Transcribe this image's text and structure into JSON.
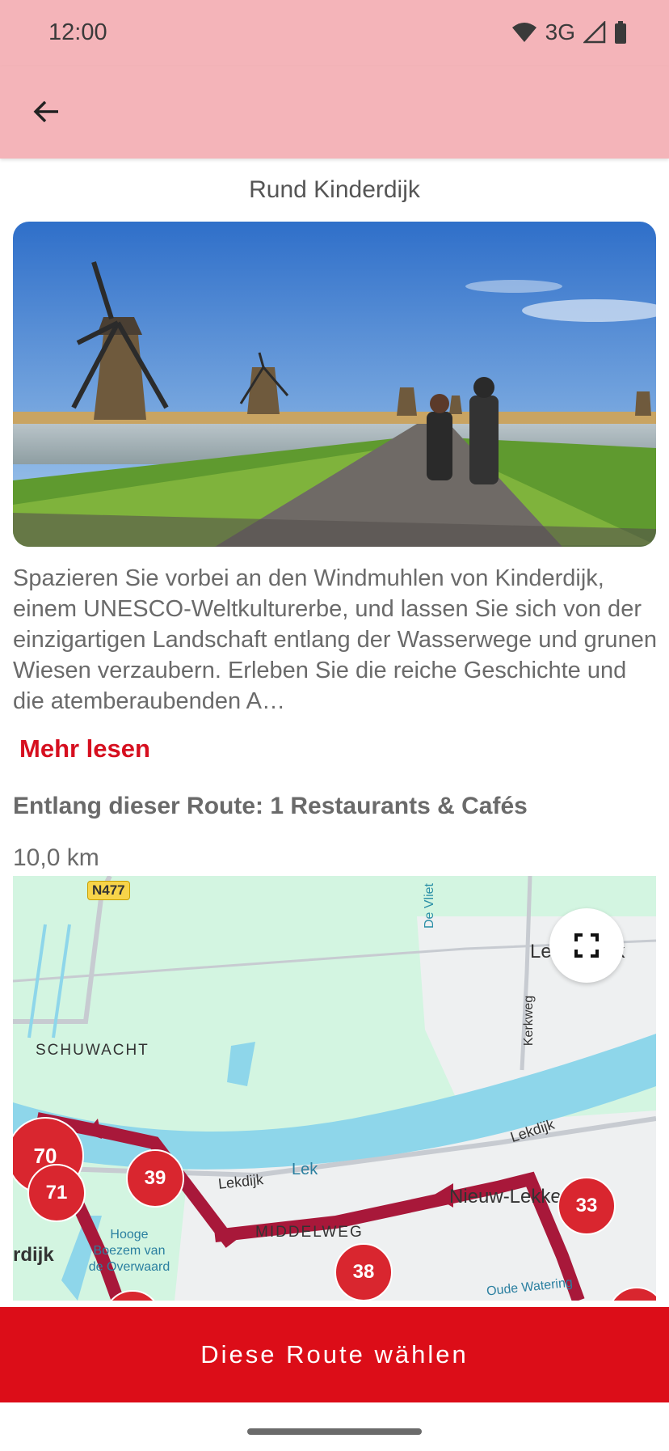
{
  "status": {
    "time": "12:00",
    "network": "3G"
  },
  "header": {
    "title": "Rund Kinderdijk"
  },
  "hero": {
    "alt": "Windmühlen in Kinderdijk"
  },
  "description": "Spazieren Sie vorbei an den Windmuhlen von Kinderdijk, einem UNESCO-Weltkulturerbe, und lassen Sie sich von der einzigartigen Landschaft entlang der Wasserwege und grunen Wiesen verzaubern. Erleben Sie die reiche Geschichte und die atemberaubenden A…",
  "read_more": "Mehr lesen",
  "along_route": "Entlang dieser Route: 1 Restaurants & Cafés",
  "distance": "10,0 km",
  "map": {
    "labels": {
      "road_n477": "N477",
      "de_vliet": "De Vliet",
      "lekkerkerk": "Lekkerkerk",
      "kerkweg": "Kerkweg",
      "schuwacht": "SCHUWACHT",
      "lekdijk_east": "Lekdijk",
      "lek": "Lek",
      "lekdijk_west": "Lekdijk",
      "nieuw_lekkerland": "Nieuw-Lekkerland",
      "middelweg": "MIDDELWEG",
      "kinderdijk_partial": "rdijk",
      "hooge_boezem": "Hooge\nBoezem van\nde Overwaard",
      "oude_watering": "Oude Watering"
    },
    "markers": [
      "70",
      "71",
      "39",
      "38",
      "33"
    ]
  },
  "cta": {
    "label": "Diese Route wählen"
  },
  "colors": {
    "accent": "#dc0d18",
    "header_bg": "#f4b4b9",
    "route": "#a8183a"
  }
}
